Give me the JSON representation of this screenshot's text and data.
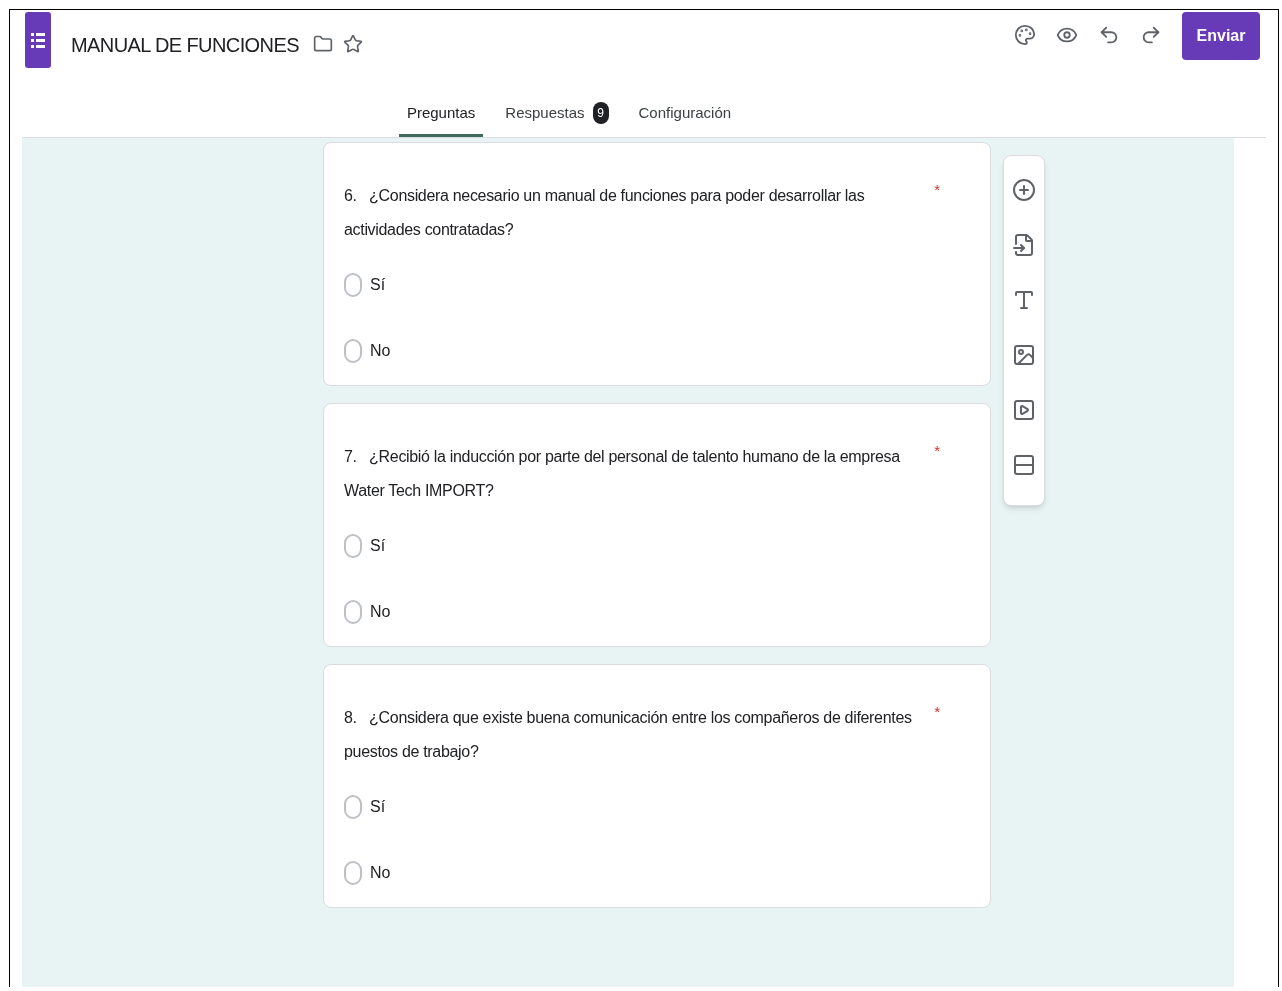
{
  "header": {
    "title": "MANUAL DE FUNCIONES",
    "send_button": "Enviar"
  },
  "tabs": [
    {
      "label": "Preguntas",
      "selected": true
    },
    {
      "label": "Respuestas",
      "selected": false,
      "badge": "9"
    },
    {
      "label": "Configuración",
      "selected": false
    }
  ],
  "questions": [
    {
      "number": "6.",
      "text": "¿Considera necesario un manual de funciones para poder desarrollar las actividades contratadas?",
      "required_mark": "*",
      "options": [
        {
          "label": "Sí",
          "selected": false
        },
        {
          "label": "No",
          "selected": false
        }
      ]
    },
    {
      "number": "7.",
      "text": "¿Recibió la inducción por parte del personal de talento humano de la empresa Water Tech IMPORT?",
      "required_mark": "*",
      "options": [
        {
          "label": "Sí",
          "selected": false
        },
        {
          "label": "No",
          "selected": false
        }
      ]
    },
    {
      "number": "8.",
      "text": "¿Considera que existe buena comunicación entre los compañeros de diferentes puestos de trabajo?",
      "required_mark": "*",
      "options": [
        {
          "label": "Sí",
          "selected": false
        },
        {
          "label": "No",
          "selected": false
        }
      ]
    }
  ]
}
